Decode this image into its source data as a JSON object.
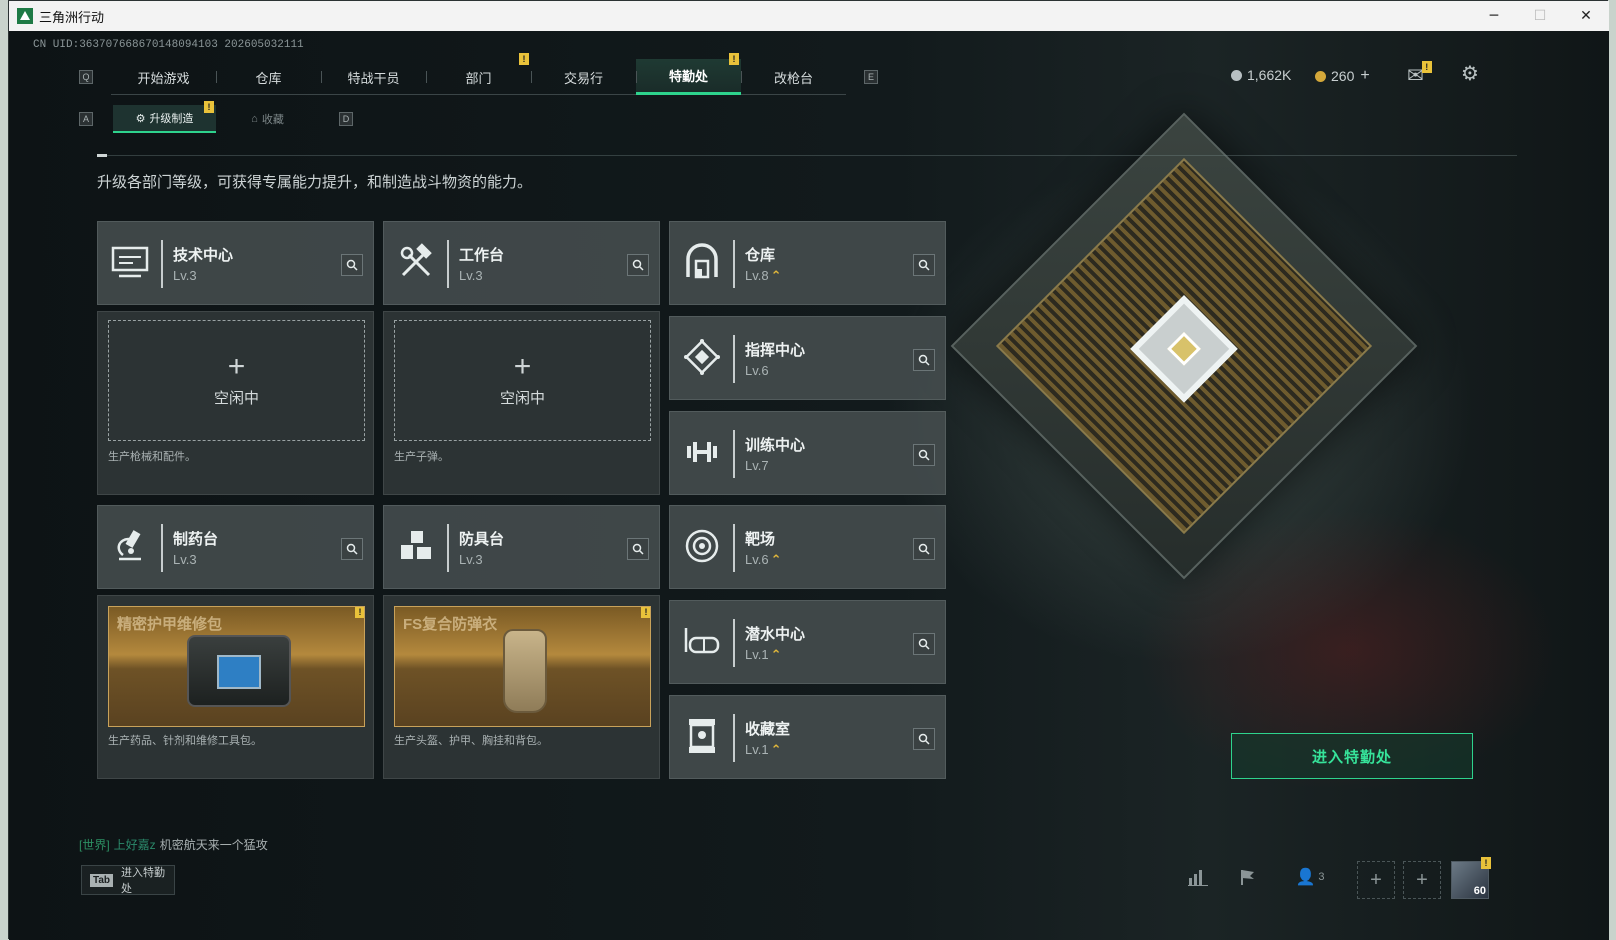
{
  "window": {
    "title": "三角洲行动",
    "controls": [
      "─",
      "☐",
      "✕"
    ]
  },
  "uid": "CN UID:363707668670148094103 202605032111",
  "nav": {
    "left_key": "Q",
    "right_key": "E",
    "tabs": [
      {
        "label": "开始游戏",
        "badge": ""
      },
      {
        "label": "仓库",
        "badge": ""
      },
      {
        "label": "特战干员",
        "badge": ""
      },
      {
        "label": "部门",
        "badge": "!"
      },
      {
        "label": "交易行",
        "badge": ""
      },
      {
        "label": "特勤处",
        "badge": "!"
      },
      {
        "label": "改枪台",
        "badge": ""
      }
    ],
    "active_tab": "特勤处"
  },
  "currency": {
    "silver": "1,662K",
    "gold": "260",
    "gold_add": "+"
  },
  "mail_badge": "!",
  "subnav": {
    "left_key": "A",
    "right_key": "D",
    "tabs": [
      {
        "label": "升级制造",
        "badge": "!"
      },
      {
        "label": "收藏",
        "badge": ""
      }
    ]
  },
  "intro": "升级各部门等级，可获得专属能力提升，和制造战斗物资的能力。",
  "facilities": {
    "tech": {
      "name": "技术中心",
      "level": "Lv.3",
      "up": ""
    },
    "workbench": {
      "name": "工作台",
      "level": "Lv.3",
      "up": ""
    },
    "warehouse": {
      "name": "仓库",
      "level": "Lv.8",
      "up": "⌃"
    },
    "command": {
      "name": "指挥中心",
      "level": "Lv.6",
      "up": ""
    },
    "training": {
      "name": "训练中心",
      "level": "Lv.7",
      "up": ""
    },
    "pharmacy": {
      "name": "制药台",
      "level": "Lv.3",
      "up": ""
    },
    "armor": {
      "name": "防具台",
      "level": "Lv.3",
      "up": ""
    },
    "range": {
      "name": "靶场",
      "level": "Lv.6",
      "up": "⌃"
    },
    "diving": {
      "name": "潜水中心",
      "level": "Lv.1",
      "up": "⌃"
    },
    "collection": {
      "name": "收藏室",
      "level": "Lv.1",
      "up": "⌃"
    }
  },
  "slots": {
    "tech": {
      "plus": "+",
      "status": "空闲中",
      "desc": "生产枪械和配件。"
    },
    "workbench": {
      "plus": "+",
      "status": "空闲中",
      "desc": "生产子弹。"
    },
    "pharmacy": {
      "product": "精密护甲维修包",
      "desc": "生产药品、针剂和维修工具包。",
      "badge": "!"
    },
    "armor": {
      "product": "FS复合防弹衣",
      "desc": "生产头盔、护甲、胸挂和背包。",
      "badge": "!"
    }
  },
  "enter_button": "进入特勤处",
  "chat": {
    "channel": "[世界]",
    "user": "上好嘉z",
    "message": "机密航天来一个猛攻"
  },
  "tab_hint": {
    "key": "Tab",
    "label": "进入特勤处"
  },
  "bottom": {
    "friends_count": "3",
    "avatar_level": "60",
    "avatar_badge": "!",
    "slot_plus": "+"
  },
  "colors": {
    "accent": "#2ed38d",
    "badge": "#e9c23a",
    "upgrade": "#e3b93a"
  }
}
